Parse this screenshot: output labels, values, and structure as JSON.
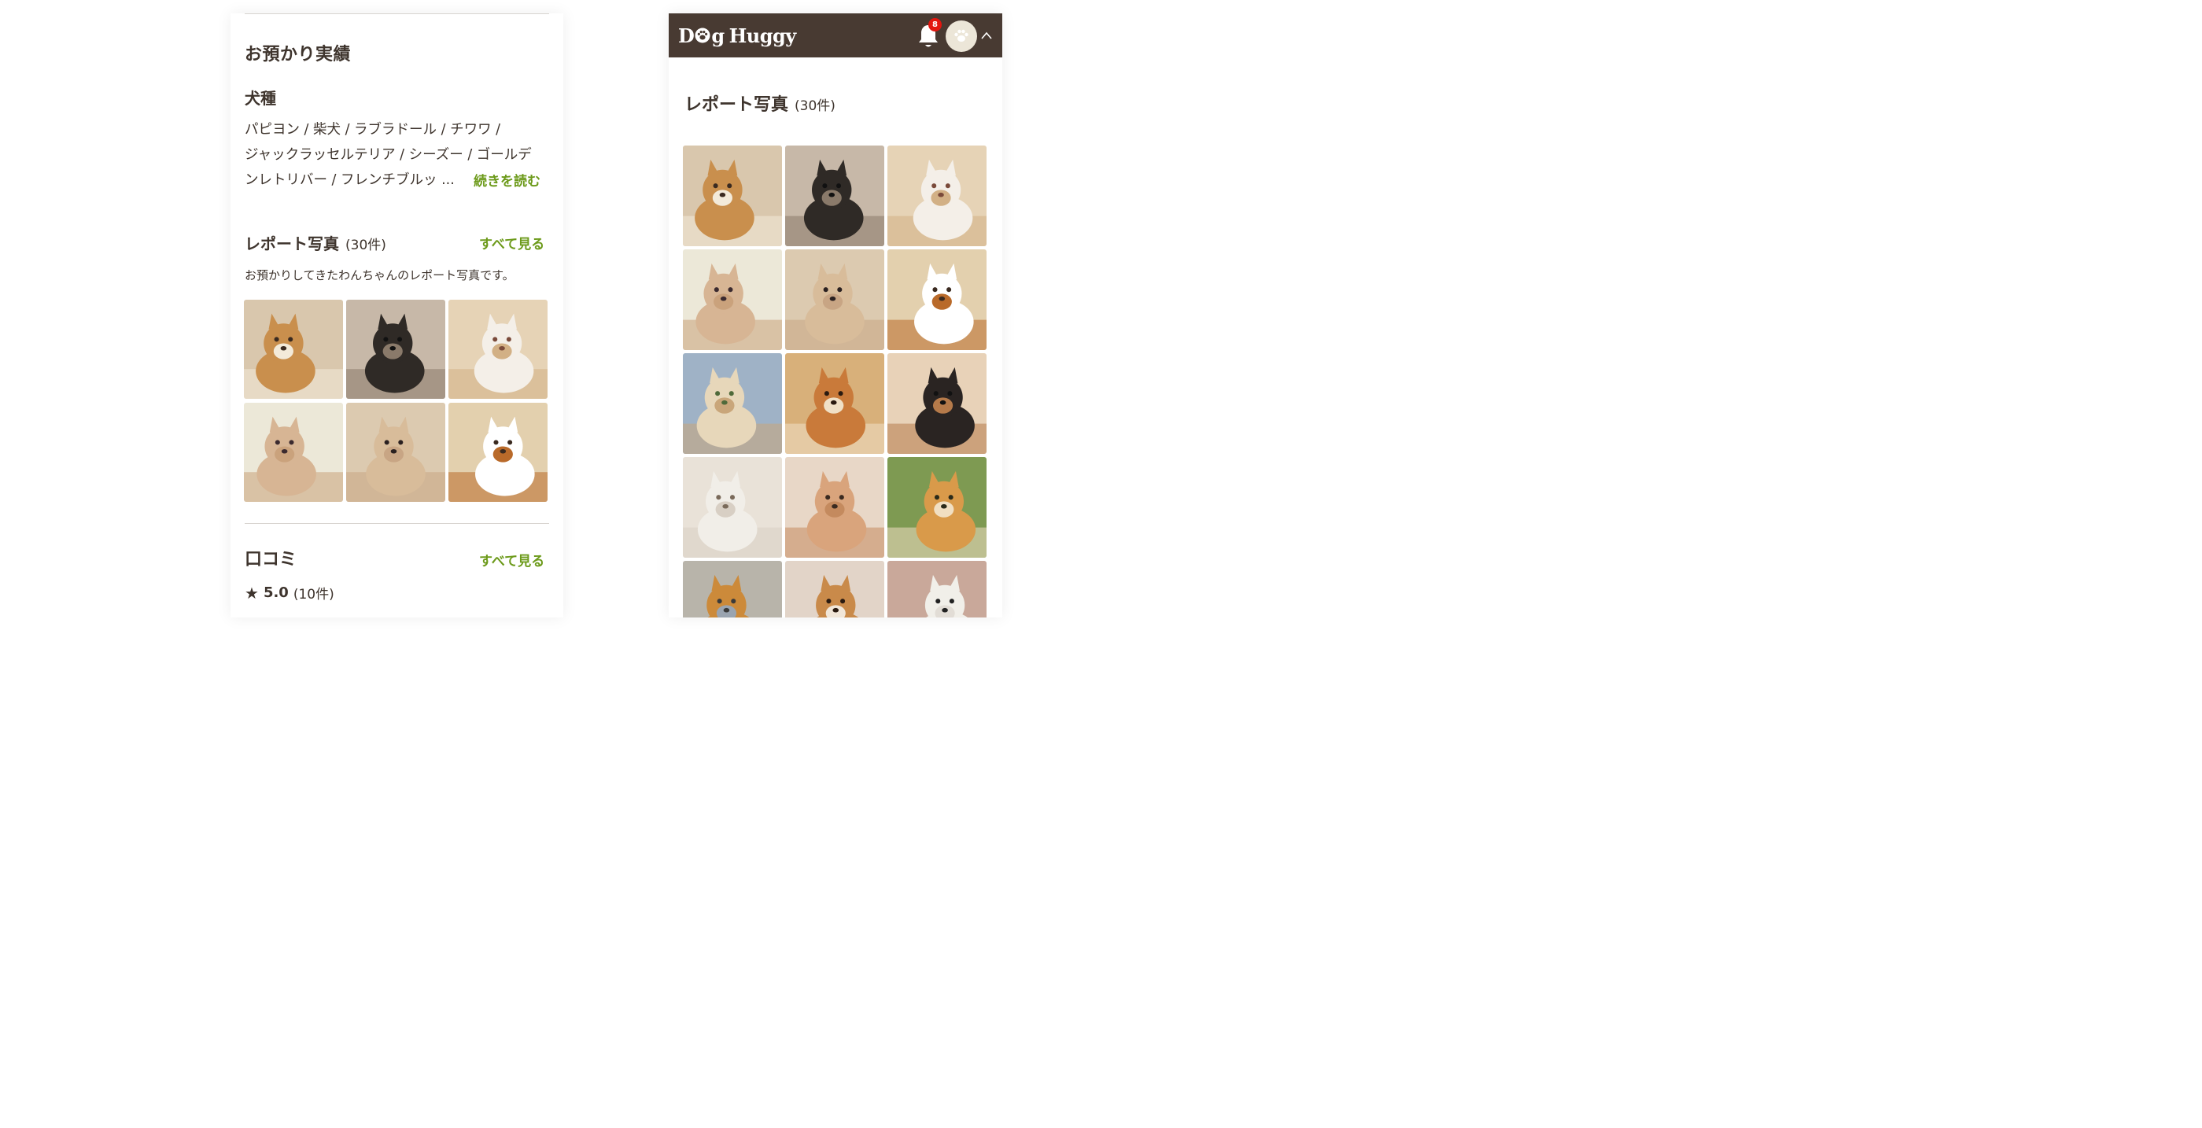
{
  "left": {
    "section_title": "お預かり実績",
    "breed_heading": "犬種",
    "breed_lines": [
      "パピヨン / 柴犬 / ラブラドール / チワワ /",
      "ジャックラッセルテリア / シーズー / ゴールデ",
      "ンレトリバー / フレンチブルッ ..."
    ],
    "read_more": "続きを読む",
    "photos_heading": "レポート写真",
    "photos_count": "(30件)",
    "see_all": "すべて見る",
    "photos_desc": "お預かりしてきたわんちゃんのレポート写真です。",
    "reviews_heading": "口コミ",
    "reviews_see_all": "すべて見る",
    "rating_score": "5.0",
    "rating_count": "(10件)"
  },
  "right": {
    "logo_text_1": "D",
    "logo_text_2": "g",
    "logo_text_3": "Huggy",
    "notification_count": "8",
    "page_title": "レポート写真",
    "page_count": "(30件)"
  },
  "colors": {
    "header_bg": "#483a32",
    "accent_green": "#6c9a1a",
    "badge_red": "#e3160f",
    "text": "#3e342d"
  },
  "icons": [
    "bell-icon",
    "paw-icon",
    "chevron-up-icon",
    "star-icon"
  ]
}
